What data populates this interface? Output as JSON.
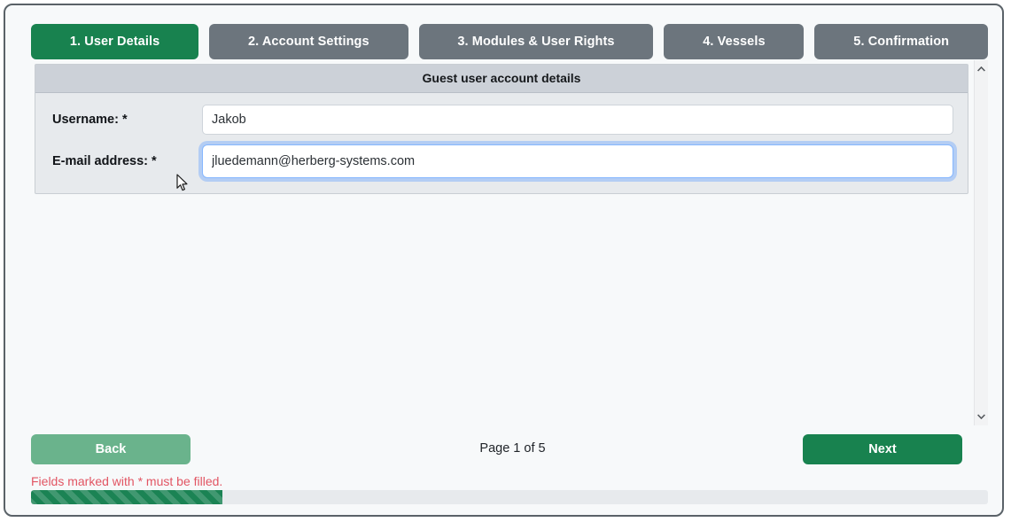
{
  "wizard": {
    "tabs": [
      {
        "label": "1. User Details",
        "active": true
      },
      {
        "label": "2. Account Settings",
        "active": false
      },
      {
        "label": "3. Modules & User Rights",
        "active": false
      },
      {
        "label": "4. Vessels",
        "active": false
      },
      {
        "label": "5. Confirmation",
        "active": false
      }
    ]
  },
  "panel": {
    "legend": "Guest user account details",
    "fields": [
      {
        "label": "Username: *",
        "value": "Jakob",
        "placeholder": "",
        "focused": false
      },
      {
        "label": "E-mail address: *",
        "value": "jluedemann@herberg-systems.com",
        "placeholder": "",
        "focused": true
      }
    ]
  },
  "scrollbar": {
    "up_icon": "chevron-up-icon",
    "down_icon": "chevron-down-icon"
  },
  "footer": {
    "back_label": "Back",
    "next_label": "Next",
    "page_indicator": "Page 1 of 5",
    "error_message": "Fields marked with * must be filled.",
    "progress_percent": 20
  },
  "colors": {
    "accent_green": "#18824f",
    "muted_green": "#6ab38c",
    "tab_gray": "#6c757d",
    "error_red": "#e25563",
    "focus_blue": "#86b7fe",
    "legend_gray": "#ccd1d8",
    "panel_gray": "#e7eaed"
  }
}
